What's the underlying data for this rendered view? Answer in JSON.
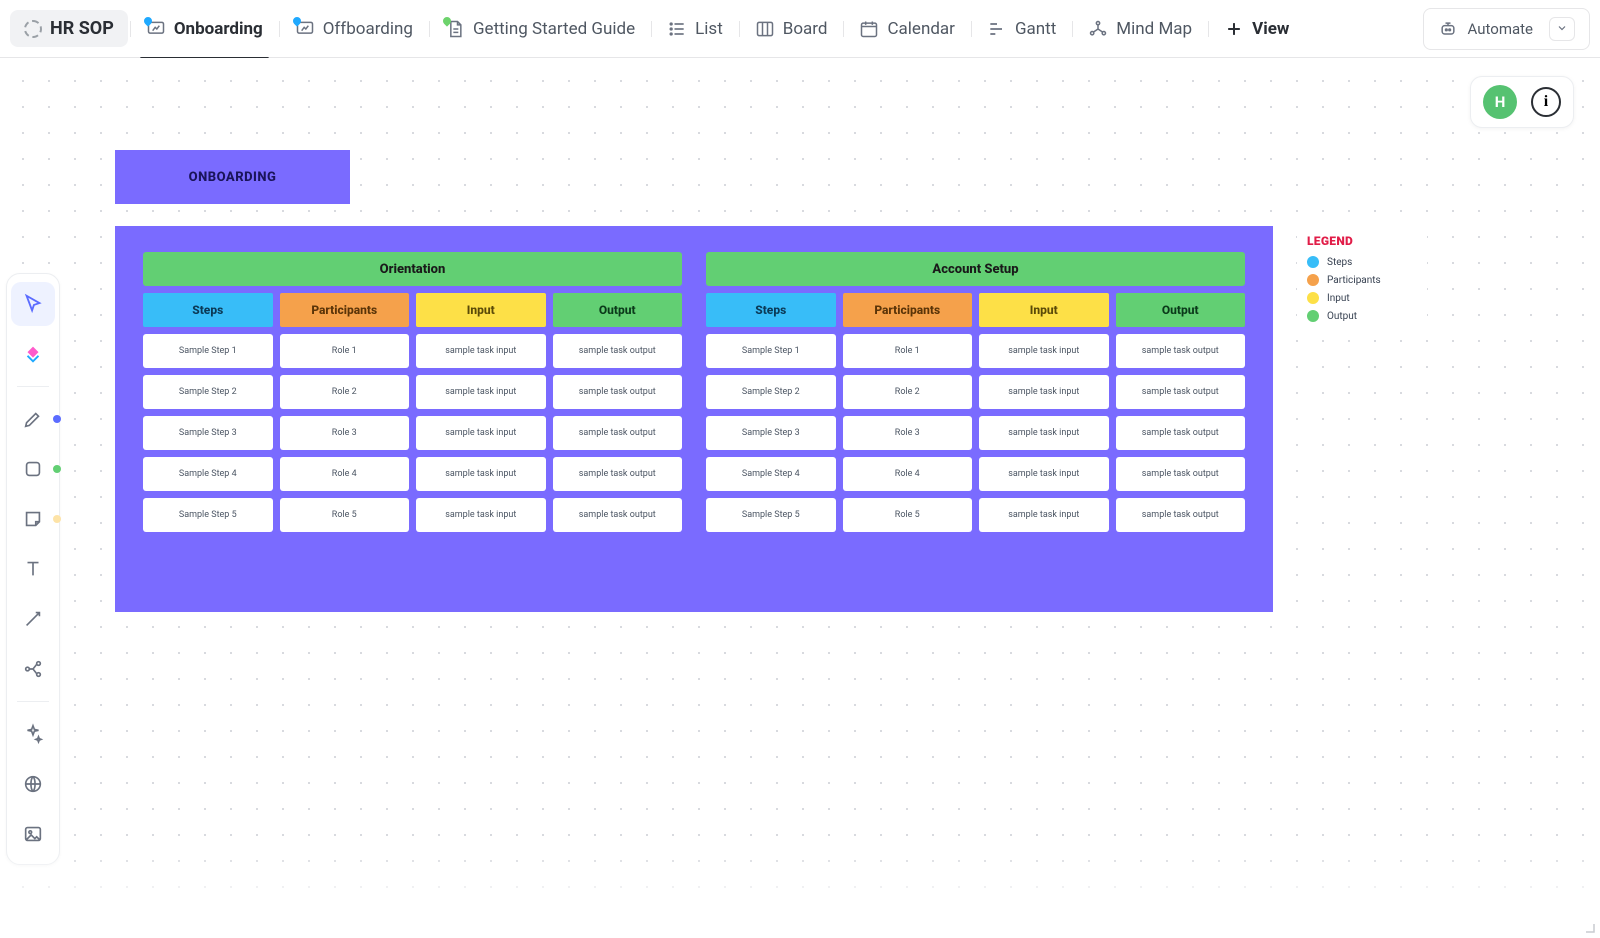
{
  "topbar": {
    "doc_title": "HR SOP",
    "tabs": [
      {
        "label": "Onboarding",
        "kind": "whiteboard",
        "active": true
      },
      {
        "label": "Offboarding",
        "kind": "whiteboard",
        "active": false
      },
      {
        "label": "Getting Started Guide",
        "kind": "doc",
        "active": false
      },
      {
        "label": "List",
        "kind": "list",
        "active": false
      },
      {
        "label": "Board",
        "kind": "board",
        "active": false
      },
      {
        "label": "Calendar",
        "kind": "calendar",
        "active": false
      },
      {
        "label": "Gantt",
        "kind": "gantt",
        "active": false
      },
      {
        "label": "Mind Map",
        "kind": "mindmap",
        "active": false
      }
    ],
    "add_view_label": "View",
    "automate_label": "Automate"
  },
  "avatar_initial": "H",
  "whiteboard": {
    "title": "ONBOARDING",
    "columns": {
      "steps": "Steps",
      "participants": "Participants",
      "input": "Input",
      "output": "Output"
    },
    "sections": [
      {
        "title": "Orientation",
        "rows": [
          {
            "step": "Sample Step 1",
            "role": "Role 1",
            "input": "sample task input",
            "output": "sample task output"
          },
          {
            "step": "Sample Step 2",
            "role": "Role 2",
            "input": "sample task input",
            "output": "sample task output"
          },
          {
            "step": "Sample Step 3",
            "role": "Role 3",
            "input": "sample task input",
            "output": "sample task output"
          },
          {
            "step": "Sample Step 4",
            "role": "Role 4",
            "input": "sample task input",
            "output": "sample task output"
          },
          {
            "step": "Sample Step 5",
            "role": "Role 5",
            "input": "sample task input",
            "output": "sample task output"
          }
        ]
      },
      {
        "title": "Account Setup",
        "rows": [
          {
            "step": "Sample Step 1",
            "role": "Role 1",
            "input": "sample task input",
            "output": "sample task output"
          },
          {
            "step": "Sample Step 2",
            "role": "Role 2",
            "input": "sample task input",
            "output": "sample task output"
          },
          {
            "step": "Sample Step 3",
            "role": "Role 3",
            "input": "sample task input",
            "output": "sample task output"
          },
          {
            "step": "Sample Step 4",
            "role": "Role 4",
            "input": "sample task input",
            "output": "sample task output"
          },
          {
            "step": "Sample Step 5",
            "role": "Role 5",
            "input": "sample task input",
            "output": "sample task output"
          }
        ]
      }
    ]
  },
  "legend": {
    "title": "LEGEND",
    "items": [
      {
        "key": "steps",
        "label": "Steps"
      },
      {
        "key": "participants",
        "label": "Participants"
      },
      {
        "key": "input",
        "label": "Input"
      },
      {
        "key": "output",
        "label": "Output"
      }
    ]
  },
  "colors": {
    "purple": "#7a6bff",
    "green": "#62cf73",
    "blue": "#38bdf8",
    "orange": "#f5a14b",
    "yellow": "#fde047"
  }
}
